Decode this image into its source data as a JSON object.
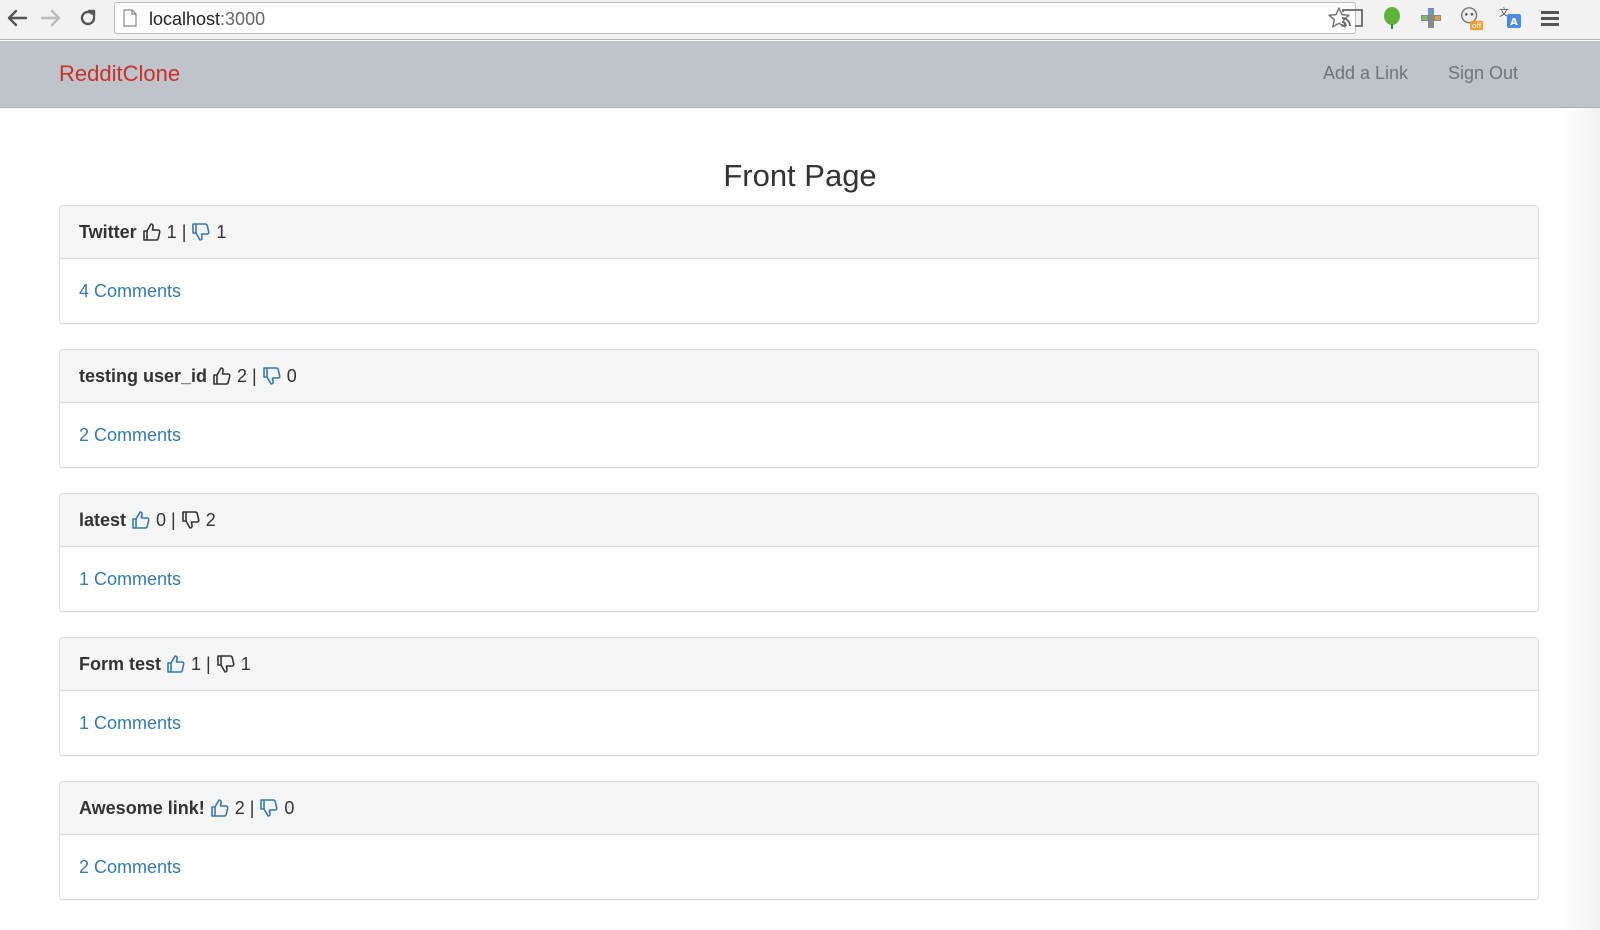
{
  "browser": {
    "url_host": "localhost",
    "url_port": ":3000"
  },
  "navbar": {
    "brand": "RedditClone",
    "add_link": "Add a Link",
    "sign_out": "Sign Out"
  },
  "main": {
    "title": "Front Page"
  },
  "posts": [
    {
      "title": "Twitter",
      "upvotes": "1",
      "downvotes": "1",
      "comments": "4 Comments",
      "up_active": false,
      "down_active": true
    },
    {
      "title": "testing user_id",
      "upvotes": "2",
      "downvotes": "0",
      "comments": "2 Comments",
      "up_active": false,
      "down_active": true
    },
    {
      "title": "latest",
      "upvotes": "0",
      "downvotes": "2",
      "comments": "1 Comments",
      "up_active": true,
      "down_active": false
    },
    {
      "title": "Form test",
      "upvotes": "1",
      "downvotes": "1",
      "comments": "1 Comments",
      "up_active": true,
      "down_active": false
    },
    {
      "title": "Awesome link!",
      "upvotes": "2",
      "downvotes": "0",
      "comments": "2 Comments",
      "up_active": true,
      "down_active": true
    }
  ],
  "separator": "|",
  "colors": {
    "brand": "#c9302c",
    "link": "#337ab7",
    "navbar_bg": "#bec4c9"
  }
}
